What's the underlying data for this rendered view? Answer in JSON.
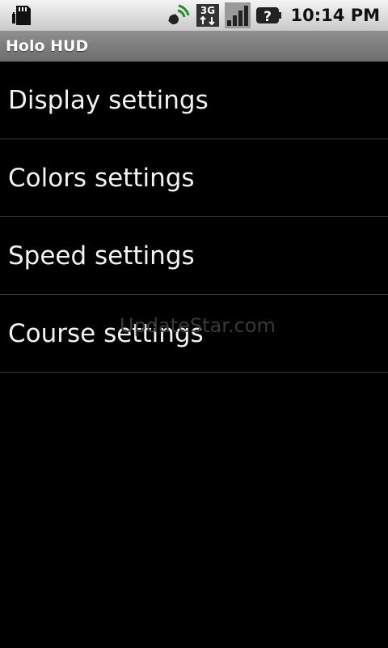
{
  "status_bar": {
    "time": "10:14 PM",
    "network": "3G",
    "icons": [
      "sd-card-icon",
      "gps-icon",
      "network-3g-icon",
      "signal-icon",
      "battery-unknown-icon"
    ]
  },
  "title_bar": {
    "title": "Holo HUD"
  },
  "menu": {
    "items": [
      {
        "label": "Display settings"
      },
      {
        "label": "Colors settings"
      },
      {
        "label": "Speed settings"
      },
      {
        "label": "Course settings"
      }
    ]
  },
  "watermark": "UpdateStar.com",
  "colors": {
    "background": "#000000",
    "title_bar": "#7d7d7d",
    "status_bar": "#dcdcdc",
    "text": "#f2f2f2",
    "divider": "#3a3a3a"
  }
}
